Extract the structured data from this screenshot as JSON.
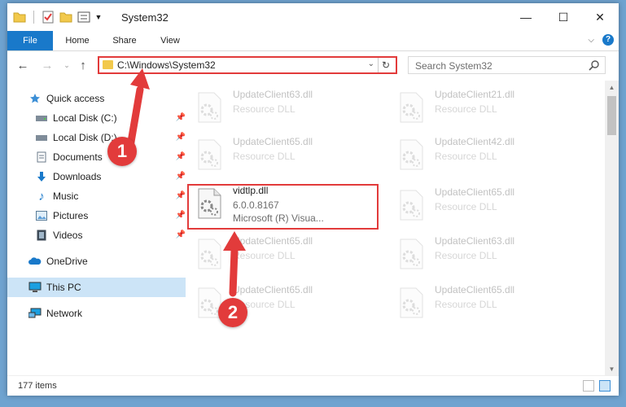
{
  "window": {
    "title": "System32",
    "controls": {
      "minimize": "—",
      "maximize": "☐",
      "close": "✕"
    }
  },
  "ribbon": {
    "tabs": [
      "File",
      "Home",
      "Share",
      "View"
    ]
  },
  "navbar": {
    "address": "C:\\Windows\\System32",
    "search_placeholder": "Search System32"
  },
  "sidebar": {
    "items": [
      {
        "label": "Quick access",
        "icon": "star-icon",
        "pinned": false
      },
      {
        "label": "Local Disk (C:)",
        "icon": "drive-icon",
        "pinned": true
      },
      {
        "label": "Local Disk (D:)",
        "icon": "drive-icon",
        "pinned": true
      },
      {
        "label": "Documents",
        "icon": "document-icon",
        "pinned": true
      },
      {
        "label": "Downloads",
        "icon": "download-icon",
        "pinned": true
      },
      {
        "label": "Music",
        "icon": "music-icon",
        "pinned": true
      },
      {
        "label": "Pictures",
        "icon": "picture-icon",
        "pinned": true
      },
      {
        "label": "Videos",
        "icon": "video-icon",
        "pinned": true
      },
      {
        "label": "OneDrive",
        "icon": "cloud-icon",
        "pinned": false
      },
      {
        "label": "This PC",
        "icon": "computer-icon",
        "pinned": false,
        "selected": true
      },
      {
        "label": "Network",
        "icon": "network-icon",
        "pinned": false
      }
    ]
  },
  "files": {
    "left": [
      {
        "name": "UpdateClient63.dll",
        "type": "Resource DLL",
        "faded": true
      },
      {
        "name": "UpdateClient65.dll",
        "type": "Resource DLL",
        "faded": true
      },
      {
        "name": "vidtlp.dll",
        "version": "6.0.0.8167",
        "company": "Microsoft (R) Visua...",
        "faded": false
      },
      {
        "name": "UpdateClient65.dll",
        "type": "Resource DLL",
        "faded": true
      },
      {
        "name": "UpdateClient65.dll",
        "type": "Resource DLL",
        "faded": true
      }
    ],
    "right": [
      {
        "name": "UpdateClient21.dll",
        "type": "Resource DLL",
        "faded": true
      },
      {
        "name": "UpdateClient42.dll",
        "type": "Resource DLL",
        "faded": true
      },
      {
        "name": "UpdateClient65.dll",
        "type": "Resource DLL",
        "faded": true
      },
      {
        "name": "UpdateClient63.dll",
        "type": "Resource DLL",
        "faded": true
      },
      {
        "name": "UpdateClient65.dll",
        "type": "Resource DLL",
        "faded": true
      }
    ]
  },
  "status": {
    "item_count": "177 items"
  },
  "annotations": {
    "step1": "1",
    "step2": "2"
  },
  "colors": {
    "accent": "#1979ca",
    "highlight": "#e23b3b",
    "selection": "#cce4f7"
  }
}
